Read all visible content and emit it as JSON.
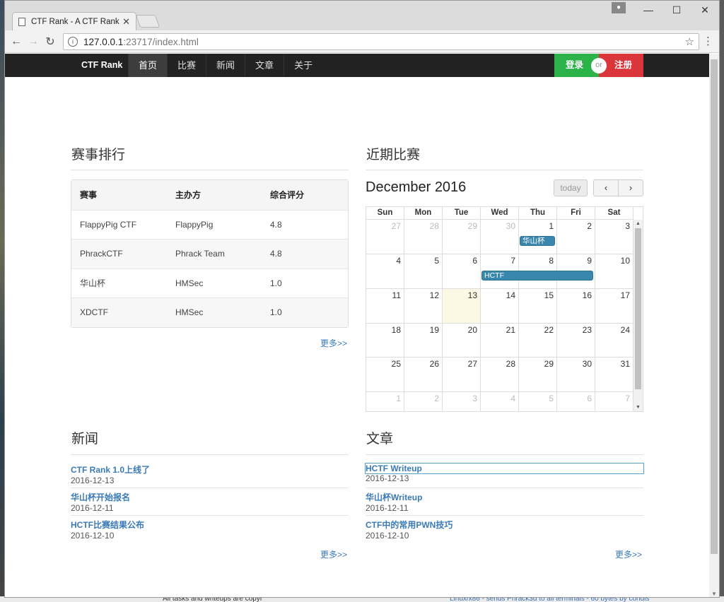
{
  "browser": {
    "tab_title": "CTF Rank - A CTF Rank",
    "url_host": "127.0.0.1",
    "url_path": ":23717/index.html"
  },
  "navbar": {
    "brand": "CTF Rank",
    "items": [
      "首页",
      "比赛",
      "新闻",
      "文章",
      "关于"
    ],
    "login": "登录",
    "or": "or",
    "register": "注册"
  },
  "ranking": {
    "title": "赛事排行",
    "headers": [
      "赛事",
      "主办方",
      "综合评分"
    ],
    "rows": [
      [
        "FlappyPig CTF",
        "FlappyPig",
        "4.8"
      ],
      [
        "PhrackCTF",
        "Phrack Team",
        "4.8"
      ],
      [
        "华山杯",
        "HMSec",
        "1.0"
      ],
      [
        "XDCTF",
        "HMSec",
        "1.0"
      ]
    ],
    "more": "更多>>"
  },
  "calendar": {
    "section_title": "近期比赛",
    "month_title": "December 2016",
    "today_label": "today",
    "prev": "‹",
    "next": "›",
    "weekdays": [
      "Sun",
      "Mon",
      "Tue",
      "Wed",
      "Thu",
      "Fri",
      "Sat"
    ],
    "weeks": [
      [
        "27",
        "28",
        "29",
        "30",
        "1",
        "2",
        "3"
      ],
      [
        "4",
        "5",
        "6",
        "7",
        "8",
        "9",
        "10"
      ],
      [
        "11",
        "12",
        "13",
        "14",
        "15",
        "16",
        "17"
      ],
      [
        "18",
        "19",
        "20",
        "21",
        "22",
        "23",
        "24"
      ],
      [
        "25",
        "26",
        "27",
        "28",
        "29",
        "30",
        "31"
      ],
      [
        "1",
        "2",
        "3",
        "4",
        "5",
        "6",
        "7"
      ]
    ],
    "events": [
      {
        "title": "华山杯"
      },
      {
        "title": "HCTF"
      }
    ]
  },
  "news": {
    "title": "新闻",
    "items": [
      {
        "title": "CTF Rank 1.0上线了",
        "date": "2016-12-13"
      },
      {
        "title": "华山杯开始报名",
        "date": "2016-12-11"
      },
      {
        "title": "HCTF比赛结果公布",
        "date": "2016-12-10"
      }
    ],
    "more": "更多>>"
  },
  "articles": {
    "title": "文章",
    "items": [
      {
        "title": "HCTF Writeup",
        "date": "2016-12-13"
      },
      {
        "title": "华山杯Writeup",
        "date": "2016-12-11"
      },
      {
        "title": "CTF中的常用PWN技巧",
        "date": "2016-12-10"
      }
    ],
    "more": "更多>>"
  },
  "desktop": {
    "bottom_left_text": "All tasks and writeups are copyr",
    "bottom_right_text": "Linux/x86 - sends Phrack3d to all terminals - 60 bytes  by condis"
  }
}
